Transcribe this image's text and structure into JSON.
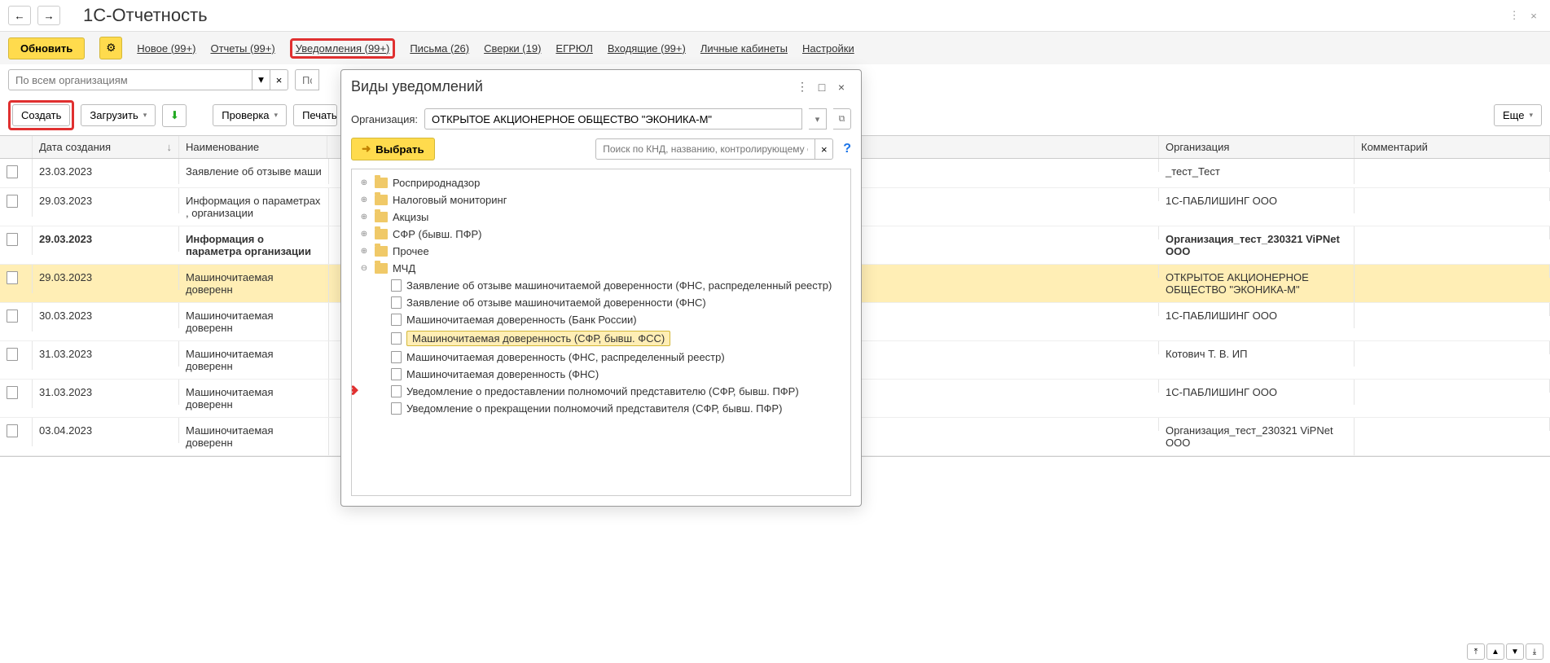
{
  "page_title": "1C-Отчетность",
  "toolbar": {
    "refresh": "Обновить",
    "nav": [
      "Новое (99+)",
      "Отчеты (99+)",
      "Уведомления (99+)",
      "Письма (26)",
      "Сверки (19)",
      "ЕГРЮЛ",
      "Входящие (99+)",
      "Личные кабинеты",
      "Настройки"
    ]
  },
  "filters": {
    "org_placeholder": "По всем организациям",
    "search_placeholder": "Пои"
  },
  "actions": {
    "create": "Создать",
    "load": "Загрузить",
    "check": "Проверка",
    "print": "Печать",
    "more": "Еще"
  },
  "table": {
    "headers": {
      "date": "Дата создания",
      "name": "Наименование",
      "org": "Организация",
      "comment": "Комментарий"
    },
    "rows": [
      {
        "date": "23.03.2023",
        "name": "Заявление об отзыве маши",
        "org": "_тест_Тест",
        "bold": false,
        "hl": false
      },
      {
        "date": "29.03.2023",
        "name": "Информация о параметрах , организации",
        "org": "1С-ПАБЛИШИНГ ООО",
        "bold": false,
        "hl": false
      },
      {
        "date": "29.03.2023",
        "name": "Информация о параметра организации",
        "org": "Организация_тест_230321 ViPNet ООО",
        "bold": true,
        "hl": false
      },
      {
        "date": "29.03.2023",
        "name": "Машиночитаемая доверенн",
        "org": "ОТКРЫТОЕ АКЦИОНЕРНОЕ ОБЩЕСТВО \"ЭКОНИКА-М\"",
        "bold": false,
        "hl": true
      },
      {
        "date": "30.03.2023",
        "name": "Машиночитаемая доверенн",
        "org": "1С-ПАБЛИШИНГ ООО",
        "bold": false,
        "hl": false
      },
      {
        "date": "31.03.2023",
        "name": "Машиночитаемая доверенн",
        "org": "Котович Т. В. ИП",
        "bold": false,
        "hl": false
      },
      {
        "date": "31.03.2023",
        "name": "Машиночитаемая доверенн",
        "org": "1С-ПАБЛИШИНГ ООО",
        "bold": false,
        "hl": false
      },
      {
        "date": "03.04.2023",
        "name": "Машиночитаемая доверенн",
        "org": "Организация_тест_230321 ViPNet ООО",
        "bold": false,
        "hl": false
      }
    ]
  },
  "modal": {
    "title": "Виды уведомлений",
    "org_label": "Организация:",
    "org_value": "ОТКРЫТОЕ АКЦИОНЕРНОЕ ОБЩЕСТВО \"ЭКОНИКА-М\"",
    "select_btn": "Выбрать",
    "search_placeholder": "Поиск по КНД, названию, контролирующему о...",
    "tree": {
      "folders": [
        "Росприроднадзор",
        "Налоговый мониторинг",
        "Акцизы",
        "СФР (бывш. ПФР)",
        "Прочее",
        "МЧД"
      ],
      "mchd_items": [
        "Заявление об отзыве машиночитаемой доверенности (ФНС, распределенный реестр)",
        "Заявление об отзыве машиночитаемой доверенности (ФНС)",
        "Машиночитаемая доверенность (Банк России)",
        "Машиночитаемая доверенность (СФР, бывш. ФСС)",
        "Машиночитаемая доверенность (ФНС, распределенный реестр)",
        "Машиночитаемая доверенность (ФНС)",
        "Уведомление о предоставлении полномочий представителю (СФР, бывш. ПФР)",
        "Уведомление о прекращении полномочий представителя (СФР, бывш. ПФР)"
      ],
      "highlighted_index": 3
    }
  }
}
